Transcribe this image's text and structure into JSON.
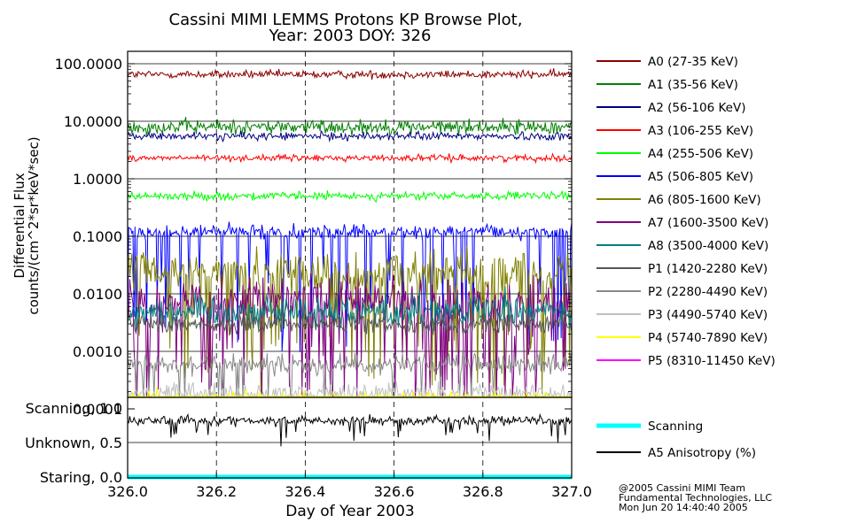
{
  "chart_data": {
    "title": "Cassini MIMI LEMMS Protons KP Browse Plot,",
    "subtitle": "Year: 2003 DOY: 326",
    "xlabel": "Day of Year 2003",
    "xlim": [
      326.0,
      327.0
    ],
    "xticks": [
      "326.0",
      "326.2",
      "326.4",
      "326.6",
      "326.8",
      "327.0"
    ],
    "panels": [
      {
        "type": "line",
        "scale": "log",
        "ylabel_line1": "Differential Flux",
        "ylabel_line2": "counts/(cm^2*sr*keV*sec)",
        "ylim": [
          0.0001,
          200
        ],
        "yticks": [
          "100.0000",
          "10.0000",
          "1.0000",
          "0.1000",
          "0.0100",
          "0.0010",
          "0.0001"
        ],
        "series": [
          {
            "name": "A0 (27-35 KeV)",
            "color": "#8b0000",
            "median": 65,
            "spread": 0.05,
            "spike": 0.0
          },
          {
            "name": "A1 (35-56 KeV)",
            "color": "#008000",
            "median": 8,
            "spread": 0.09,
            "spike": 0.0
          },
          {
            "name": "A2 (56-106 KeV)",
            "color": "#000080",
            "median": 5.5,
            "spread": 0.05,
            "spike": 0.0
          },
          {
            "name": "A3 (106-255 KeV)",
            "color": "#ff0000",
            "median": 2.3,
            "spread": 0.04,
            "spike": 0.0
          },
          {
            "name": "A4 (255-506 KeV)",
            "color": "#00ff00",
            "median": 0.5,
            "spread": 0.05,
            "spike": 0.0
          },
          {
            "name": "A5 (506-805 KeV)",
            "color": "#0000ff",
            "median": 0.12,
            "spread": 0.09,
            "spike": 0.12
          },
          {
            "name": "A6 (805-1600 KeV)",
            "color": "#808000",
            "median": 0.025,
            "spread": 0.22,
            "spike": 0.18
          },
          {
            "name": "A7 (1600-3500 KeV)",
            "color": "#800080",
            "median": 0.008,
            "spread": 0.25,
            "spike": 0.2
          },
          {
            "name": "A8 (3500-4000 KeV)",
            "color": "#008080",
            "median": 0.005,
            "spread": 0.2,
            "spike": 0.0
          },
          {
            "name": "P1 (1420-2280 KeV)",
            "color": "#555555",
            "median": 0.003,
            "spread": 0.12,
            "spike": 0.0
          },
          {
            "name": "P2 (2280-4490 KeV)",
            "color": "#888888",
            "median": 0.0006,
            "spread": 0.12,
            "spike": 0.08
          },
          {
            "name": "P3 (4490-5740 KeV)",
            "color": "#c0c0c0",
            "median": 0.0002,
            "spread": 0.1,
            "spike": 0.3
          },
          {
            "name": "P4 (5740-7890 KeV)",
            "color": "#ffff00",
            "median": 0.00015,
            "spread": 0.1,
            "spike": 0.35
          },
          {
            "name": "P5 (8310-11450 KeV)",
            "color": "#ff00ff",
            "median": null,
            "spread": 0,
            "spike": 0
          }
        ]
      },
      {
        "type": "line",
        "scale": "linear",
        "ylim": [
          0,
          1.0
        ],
        "yticks": [
          "Scanning, 1.0",
          "Unknown, 0.5",
          "Staring, 0.0"
        ],
        "series": [
          {
            "name": "Scanning",
            "color": "#00ffff",
            "value": 0.0
          },
          {
            "name": "A5 Anisotropy (%)",
            "color": "#000000",
            "median": 0.82,
            "spread": 0.05
          }
        ]
      }
    ],
    "grid": true,
    "legend_position": "right"
  },
  "credits": {
    "line1": "@2005 Cassini MIMI Team",
    "line2": "Fundamental Technologies, LLC",
    "line3": "Mon Jun 20 14:40:40 2005"
  }
}
